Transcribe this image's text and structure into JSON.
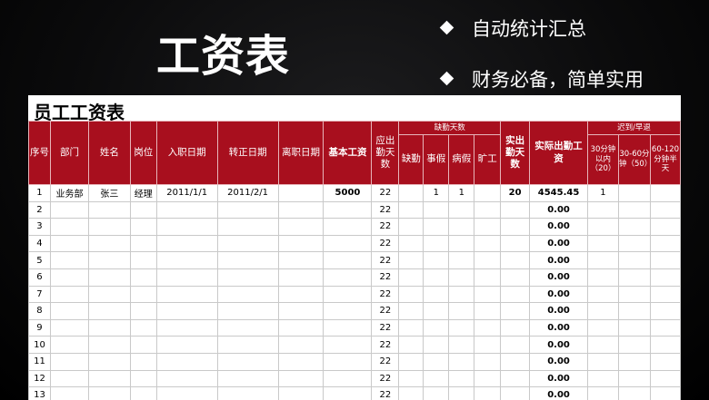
{
  "slide": {
    "title": "工资表",
    "bullets": [
      "自动统计汇总",
      "财务必备，简单实用"
    ]
  },
  "sheet": {
    "title": "员工工资表",
    "headers": {
      "seq": "序号",
      "dept": "部门",
      "name": "姓名",
      "position": "岗位",
      "hire_date": "入职日期",
      "regular_date": "转正日期",
      "leave_date": "离职日期",
      "base_salary": "基本工资",
      "required_days": "应出勤天数",
      "absence_group": "缺勤天数",
      "absence_cols": [
        "缺勤",
        "事假",
        "病假",
        "旷工"
      ],
      "actual_days": "实出勤天数",
      "actual_pay": "实际出勤工资",
      "late_group": "迟到/早退",
      "late_cols": [
        "30分钟以内（20）",
        "30-60分钟（50）",
        "60-120分钟半天"
      ]
    },
    "rows": [
      {
        "seq": "1",
        "dept": "业务部",
        "name": "张三",
        "position": "经理",
        "hire_date": "2011/1/1",
        "regular_date": "2011/2/1",
        "leave_date": "",
        "base_salary": "5000",
        "required_days": "22",
        "absent": "",
        "personal": "1",
        "sick": "1",
        "truant": "",
        "actual_days": "20",
        "actual_pay": "4545.45",
        "late30": "1",
        "late60": "",
        "late120": ""
      },
      {
        "seq": "2",
        "dept": "",
        "name": "",
        "position": "",
        "hire_date": "",
        "regular_date": "",
        "leave_date": "",
        "base_salary": "",
        "required_days": "22",
        "absent": "",
        "personal": "",
        "sick": "",
        "truant": "",
        "actual_days": "",
        "actual_pay": "0.00",
        "late30": "",
        "late60": "",
        "late120": ""
      },
      {
        "seq": "3",
        "dept": "",
        "name": "",
        "position": "",
        "hire_date": "",
        "regular_date": "",
        "leave_date": "",
        "base_salary": "",
        "required_days": "22",
        "absent": "",
        "personal": "",
        "sick": "",
        "truant": "",
        "actual_days": "",
        "actual_pay": "0.00",
        "late30": "",
        "late60": "",
        "late120": ""
      },
      {
        "seq": "4",
        "dept": "",
        "name": "",
        "position": "",
        "hire_date": "",
        "regular_date": "",
        "leave_date": "",
        "base_salary": "",
        "required_days": "22",
        "absent": "",
        "personal": "",
        "sick": "",
        "truant": "",
        "actual_days": "",
        "actual_pay": "0.00",
        "late30": "",
        "late60": "",
        "late120": ""
      },
      {
        "seq": "5",
        "dept": "",
        "name": "",
        "position": "",
        "hire_date": "",
        "regular_date": "",
        "leave_date": "",
        "base_salary": "",
        "required_days": "22",
        "absent": "",
        "personal": "",
        "sick": "",
        "truant": "",
        "actual_days": "",
        "actual_pay": "0.00",
        "late30": "",
        "late60": "",
        "late120": ""
      },
      {
        "seq": "6",
        "dept": "",
        "name": "",
        "position": "",
        "hire_date": "",
        "regular_date": "",
        "leave_date": "",
        "base_salary": "",
        "required_days": "22",
        "absent": "",
        "personal": "",
        "sick": "",
        "truant": "",
        "actual_days": "",
        "actual_pay": "0.00",
        "late30": "",
        "late60": "",
        "late120": ""
      },
      {
        "seq": "7",
        "dept": "",
        "name": "",
        "position": "",
        "hire_date": "",
        "regular_date": "",
        "leave_date": "",
        "base_salary": "",
        "required_days": "22",
        "absent": "",
        "personal": "",
        "sick": "",
        "truant": "",
        "actual_days": "",
        "actual_pay": "0.00",
        "late30": "",
        "late60": "",
        "late120": ""
      },
      {
        "seq": "8",
        "dept": "",
        "name": "",
        "position": "",
        "hire_date": "",
        "regular_date": "",
        "leave_date": "",
        "base_salary": "",
        "required_days": "22",
        "absent": "",
        "personal": "",
        "sick": "",
        "truant": "",
        "actual_days": "",
        "actual_pay": "0.00",
        "late30": "",
        "late60": "",
        "late120": ""
      },
      {
        "seq": "9",
        "dept": "",
        "name": "",
        "position": "",
        "hire_date": "",
        "regular_date": "",
        "leave_date": "",
        "base_salary": "",
        "required_days": "22",
        "absent": "",
        "personal": "",
        "sick": "",
        "truant": "",
        "actual_days": "",
        "actual_pay": "0.00",
        "late30": "",
        "late60": "",
        "late120": ""
      },
      {
        "seq": "10",
        "dept": "",
        "name": "",
        "position": "",
        "hire_date": "",
        "regular_date": "",
        "leave_date": "",
        "base_salary": "",
        "required_days": "22",
        "absent": "",
        "personal": "",
        "sick": "",
        "truant": "",
        "actual_days": "",
        "actual_pay": "0.00",
        "late30": "",
        "late60": "",
        "late120": ""
      },
      {
        "seq": "11",
        "dept": "",
        "name": "",
        "position": "",
        "hire_date": "",
        "regular_date": "",
        "leave_date": "",
        "base_salary": "",
        "required_days": "22",
        "absent": "",
        "personal": "",
        "sick": "",
        "truant": "",
        "actual_days": "",
        "actual_pay": "0.00",
        "late30": "",
        "late60": "",
        "late120": ""
      },
      {
        "seq": "12",
        "dept": "",
        "name": "",
        "position": "",
        "hire_date": "",
        "regular_date": "",
        "leave_date": "",
        "base_salary": "",
        "required_days": "22",
        "absent": "",
        "personal": "",
        "sick": "",
        "truant": "",
        "actual_days": "",
        "actual_pay": "0.00",
        "late30": "",
        "late60": "",
        "late120": ""
      },
      {
        "seq": "13",
        "dept": "",
        "name": "",
        "position": "",
        "hire_date": "",
        "regular_date": "",
        "leave_date": "",
        "base_salary": "",
        "required_days": "22",
        "absent": "",
        "personal": "",
        "sick": "",
        "truant": "",
        "actual_days": "",
        "actual_pay": "0.00",
        "late30": "",
        "late60": "",
        "late120": ""
      }
    ]
  },
  "colors": {
    "header_red": "#a80f1e",
    "background": "#000000"
  }
}
